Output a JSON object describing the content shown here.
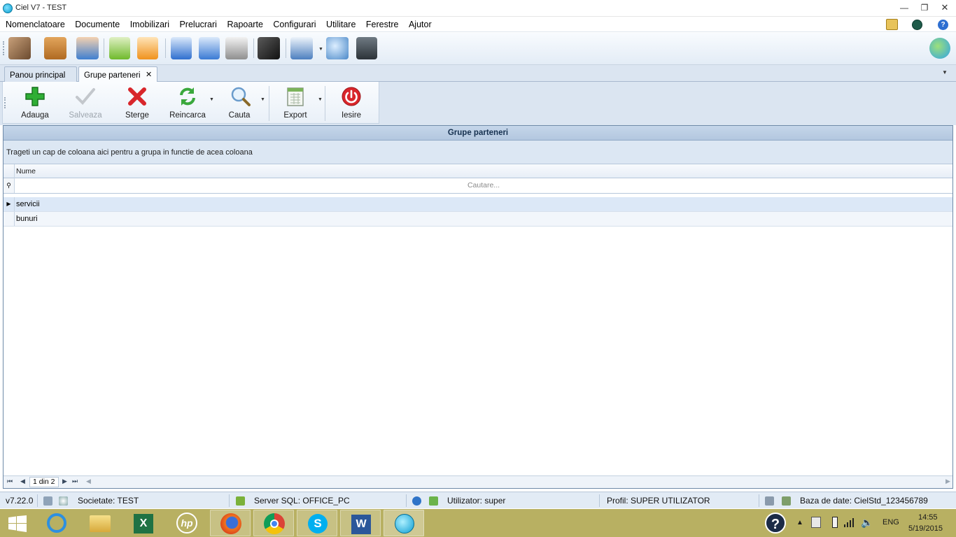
{
  "window": {
    "title": "Ciel V7 - TEST"
  },
  "menu": [
    "Nomenclatoare",
    "Documente",
    "Imobilizari",
    "Prelucrari",
    "Rapoarte",
    "Configurari",
    "Utilitare",
    "Ferestre",
    "Ajutor"
  ],
  "tabs": [
    {
      "label": "Panou principal"
    },
    {
      "label": "Grupe parteneri",
      "close": "✕"
    }
  ],
  "ribbon": {
    "add": "Adauga",
    "save": "Salveaza",
    "delete": "Sterge",
    "reload": "Reincarca",
    "search": "Cauta",
    "export": "Export",
    "exit": "Iesire"
  },
  "grid": {
    "title": "Grupe parteneri",
    "group_hint": "Trageti un cap de coloana aici pentru a grupa in functie de acea coloana",
    "column": "Nume",
    "filter_placeholder": "Cautare...",
    "rows": [
      "servicii",
      "bunuri"
    ],
    "pager": "1 din 2"
  },
  "status": {
    "version": "v7.22.0",
    "company": "Societate: TEST",
    "server": "Server SQL: OFFICE_PC",
    "user": "Utilizator: super",
    "profile": "Profil: SUPER UTILIZATOR",
    "db": "Baza de date: CielStd_123456789"
  },
  "taskbar": {
    "lang": "ENG",
    "time": "14:55",
    "date": "5/19/2015"
  },
  "colors": {
    "accent": "#dbe5f1",
    "grid_header": "#b3c7df",
    "taskbar": "#b8b062"
  }
}
